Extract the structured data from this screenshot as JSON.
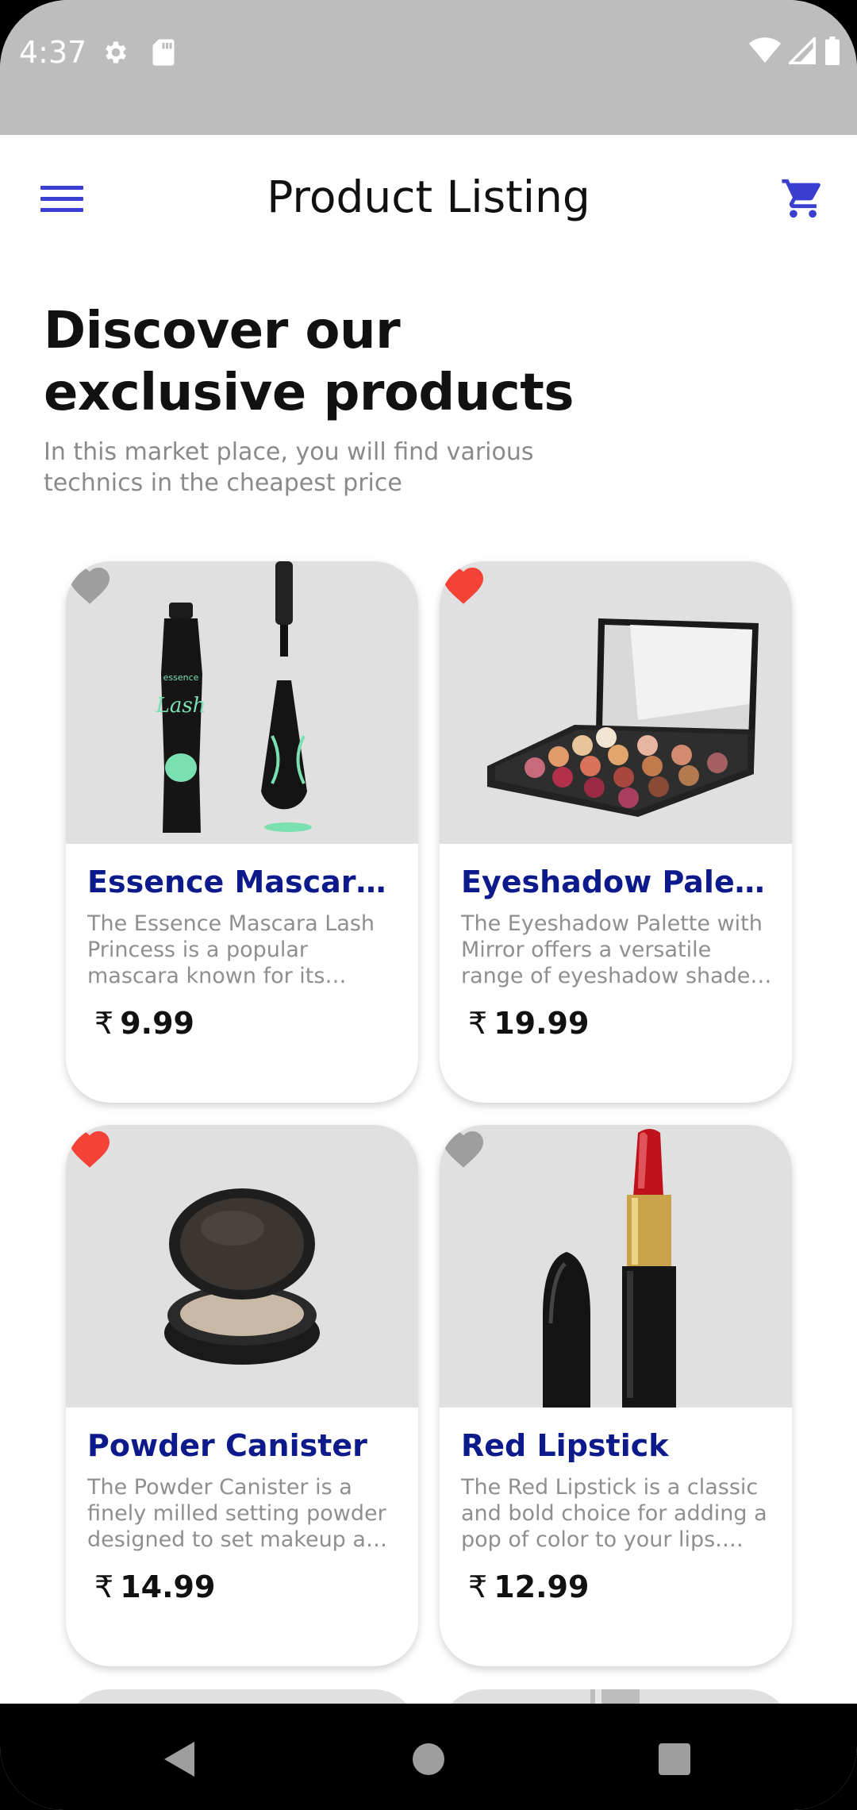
{
  "status_bar": {
    "time": "4:37"
  },
  "app_bar": {
    "title": "Product Listing",
    "menu_icon": "hamburger-menu-icon",
    "cart_icon": "shopping-cart-icon",
    "accent_color": "#3a3fd1"
  },
  "hero": {
    "title": "Discover our exclusive products",
    "subtitle": "In this market place, you will find various technics in the cheapest price"
  },
  "products": [
    {
      "name": "Essence Mascara Lash Princess",
      "description": "The Essence Mascara Lash Princess is a popular mascara known for its volumizing and lengthening effects.",
      "currency": "₹",
      "price": "9.99",
      "favorite": false
    },
    {
      "name": "Eyeshadow Palette with Mirror",
      "description": "The Eyeshadow Palette with Mirror offers a versatile range of eyeshadow shades for creating stunning looks.",
      "currency": "₹",
      "price": "19.99",
      "favorite": true
    },
    {
      "name": "Powder Canister",
      "description": "The Powder Canister is a finely milled setting powder designed to set makeup and control shine.",
      "currency": "₹",
      "price": "14.99",
      "favorite": true
    },
    {
      "name": "Red Lipstick",
      "description": "The Red Lipstick is a classic and bold choice for adding a pop of color to your lips. With a creamy formula.",
      "currency": "₹",
      "price": "12.99",
      "favorite": false
    }
  ],
  "colors": {
    "product_name": "#0d1a8c",
    "favorite_on": "#f44336",
    "favorite_off": "#9e9e9e",
    "status_bar": "#bdbdbd"
  }
}
